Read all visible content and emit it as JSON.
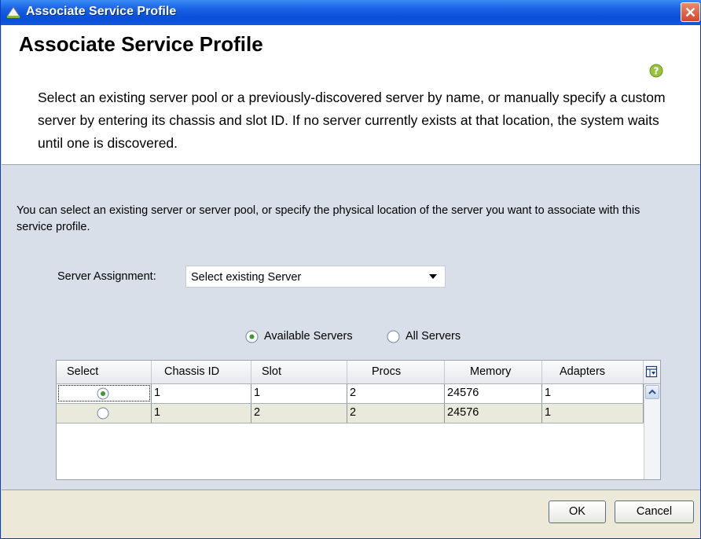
{
  "window": {
    "title": "Associate Service Profile",
    "accent": "#1a62e6",
    "close_color": "#d5462a"
  },
  "header": {
    "title": "Associate Service Profile",
    "description": "Select an existing server pool or a previously-discovered server by name, or manually specify a custom server by entering its chassis and slot ID. If no server currently exists at that location, the system waits until one is discovered.",
    "help_icon": "help-icon"
  },
  "body": {
    "intro": "You can select an existing server or server pool, or specify the physical location of the server you want to associate with this service profile.",
    "server_assignment": {
      "label": "Server Assignment:",
      "value": "Select existing Server"
    },
    "radios": [
      {
        "label": "Available Servers",
        "checked": true
      },
      {
        "label": "All Servers",
        "checked": false
      }
    ],
    "table": {
      "columns": [
        "Select",
        "Chassis ID",
        "Slot",
        "Procs",
        "Memory",
        "Adapters"
      ],
      "rows": [
        {
          "selected": true,
          "chassis_id": "1",
          "slot": "1",
          "procs": "2",
          "memory": "24576",
          "adapters": "1"
        },
        {
          "selected": false,
          "chassis_id": "1",
          "slot": "2",
          "procs": "2",
          "memory": "24576",
          "adapters": "1"
        }
      ]
    }
  },
  "footer": {
    "ok_label": "OK",
    "cancel_label": "Cancel"
  }
}
